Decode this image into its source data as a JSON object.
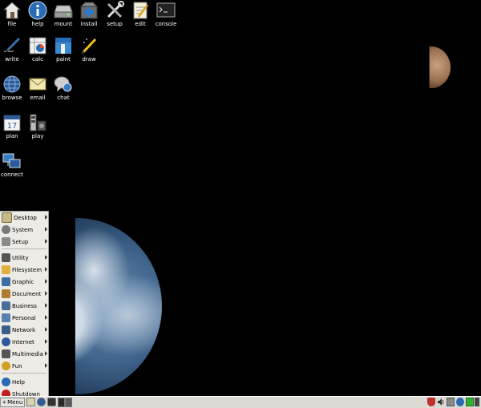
{
  "desktop": {
    "icons": [
      {
        "label": "file",
        "icon": "home-icon"
      },
      {
        "label": "help",
        "icon": "info-icon"
      },
      {
        "label": "mount",
        "icon": "drive-icon"
      },
      {
        "label": "install",
        "icon": "package-icon"
      },
      {
        "label": "setup",
        "icon": "tools-icon"
      },
      {
        "label": "edit",
        "icon": "notepad-icon"
      },
      {
        "label": "console",
        "icon": "terminal-icon"
      },
      {
        "label": "write",
        "icon": "pen-icon"
      },
      {
        "label": "calc",
        "icon": "spreadsheet-icon"
      },
      {
        "label": "paint",
        "icon": "paint-icon"
      },
      {
        "label": "draw",
        "icon": "draw-icon"
      },
      {
        "label": "browse",
        "icon": "globe-icon"
      },
      {
        "label": "email",
        "icon": "envelope-icon"
      },
      {
        "label": "chat",
        "icon": "chat-icon"
      },
      {
        "label": "plan",
        "icon": "calendar-icon"
      },
      {
        "label": "play",
        "icon": "media-icon"
      },
      {
        "label": "connect",
        "icon": "network-icon"
      }
    ],
    "calendar_day": "17"
  },
  "start_menu": {
    "items": [
      {
        "label": "Desktop",
        "icon": "desktop-icon",
        "color": "#c8b98a"
      },
      {
        "label": "System",
        "icon": "gear-icon",
        "color": "#7a7a7a"
      },
      {
        "label": "Setup",
        "icon": "tools-icon",
        "color": "#8a8a8a"
      },
      {
        "label": "Utility",
        "icon": "utility-icon",
        "color": "#555555"
      },
      {
        "label": "Filesystem",
        "icon": "folder-icon",
        "color": "#e0b040"
      },
      {
        "label": "Graphic",
        "icon": "graphic-icon",
        "color": "#3a6ea5"
      },
      {
        "label": "Document",
        "icon": "document-icon",
        "color": "#b07a30"
      },
      {
        "label": "Business",
        "icon": "business-icon",
        "color": "#4a6c9a"
      },
      {
        "label": "Personal",
        "icon": "personal-icon",
        "color": "#5a7fb0"
      },
      {
        "label": "Network",
        "icon": "network-icon",
        "color": "#3a5f8a"
      },
      {
        "label": "Internet",
        "icon": "globe-icon",
        "color": "#2a5a9a"
      },
      {
        "label": "Multimedia",
        "icon": "multimedia-icon",
        "color": "#555555"
      },
      {
        "label": "Fun",
        "icon": "fun-icon",
        "color": "#d0a020"
      }
    ],
    "help_label": "Help",
    "shutdown_label": "Shutdown"
  },
  "taskbar": {
    "menu_label": "Menu"
  }
}
